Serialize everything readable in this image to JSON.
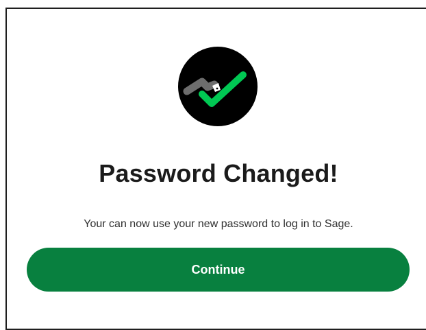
{
  "dialog": {
    "icon": "success-check-icon",
    "title": "Password Changed!",
    "message": "Your can now use your new password to log in to Sage.",
    "continue_label": "Continue"
  },
  "colors": {
    "primary_button": "#08803f",
    "check_green": "#00c853",
    "icon_background": "#000000",
    "title_text": "#1b1b1b"
  }
}
